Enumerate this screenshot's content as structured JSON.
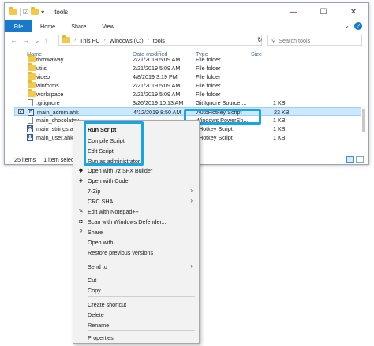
{
  "window": {
    "title": "tools",
    "controls": [
      "—",
      "☐",
      "✕"
    ],
    "ribbon_tabs": [
      "File",
      "Home",
      "Share",
      "View"
    ],
    "nav": [
      "←",
      "→",
      "⌄",
      "↑"
    ],
    "breadcrumb": [
      "This PC",
      "Windows (C:)",
      "tools"
    ],
    "search_placeholder": "Search tools"
  },
  "columns": {
    "name": "Name",
    "date": "Date modified",
    "type": "Type",
    "size": "Size"
  },
  "files": [
    {
      "name": "throwaway",
      "date": "2/21/2019 5:09 AM",
      "type": "File folder",
      "size": "",
      "kind": "folder"
    },
    {
      "name": "utils",
      "date": "2/21/2019 5:09 AM",
      "type": "File folder",
      "size": "",
      "kind": "folder"
    },
    {
      "name": "video",
      "date": "4/8/2019 3:19 PM",
      "type": "File folder",
      "size": "",
      "kind": "folder"
    },
    {
      "name": "winforms",
      "date": "2/21/2019 5:09 AM",
      "type": "File folder",
      "size": "",
      "kind": "folder"
    },
    {
      "name": "workspace",
      "date": "2/21/2019 5:09 AM",
      "type": "File folder",
      "size": "",
      "kind": "folder"
    },
    {
      "name": ".gitignore",
      "date": "3/26/2019 10:13 AM",
      "type": "Git Ignore Source ...",
      "size": "1 KB",
      "kind": "doc"
    },
    {
      "name": "main_admin.ahk",
      "date": "4/12/2019 8:50 AM",
      "type": "AutoHotkey Script",
      "size": "23 KB",
      "kind": "ahk",
      "selected": true
    },
    {
      "name": "main_chocolatey",
      "date": "",
      "type": "Windows PowerSh...",
      "size": "1 KB",
      "kind": "doc"
    },
    {
      "name": "main_strings.ahk",
      "date": "",
      "type": "oHotkey Script",
      "size": "1 KB",
      "kind": "ahk"
    },
    {
      "name": "main_user.ahk",
      "date": "",
      "type": "oHotkey Script",
      "size": "1 KB",
      "kind": "ahk"
    }
  ],
  "status": {
    "items": "25 items",
    "selected": "1 item selec"
  },
  "context_menu": [
    {
      "label": "Run Script",
      "bold": true
    },
    {
      "label": "Compile Script"
    },
    {
      "label": "Edit Script"
    },
    {
      "label": "Run as administrator"
    },
    {
      "label": "Open with 7z SFX Builder",
      "icon": "◆"
    },
    {
      "label": "Open with Code",
      "icon": "◈"
    },
    {
      "label": "7-Zip",
      "submenu": true
    },
    {
      "label": "CRC SHA",
      "submenu": true
    },
    {
      "label": "Edit with Notepad++",
      "icon": "✎"
    },
    {
      "label": "Scan with Windows Defender...",
      "icon": "◘"
    },
    {
      "label": "Share",
      "icon": "⇪"
    },
    {
      "label": "Open with..."
    },
    {
      "label": "Restore previous versions"
    },
    {
      "label": "Send to",
      "submenu": true
    },
    {
      "label": "Cut"
    },
    {
      "label": "Copy"
    },
    {
      "label": "Create shortcut"
    },
    {
      "label": "Delete"
    },
    {
      "label": "Rename"
    },
    {
      "label": "Properties"
    }
  ],
  "colors": {
    "accent": "#1979ca",
    "highlight_box": "#18a5e6",
    "selection": "#cce8ff"
  }
}
